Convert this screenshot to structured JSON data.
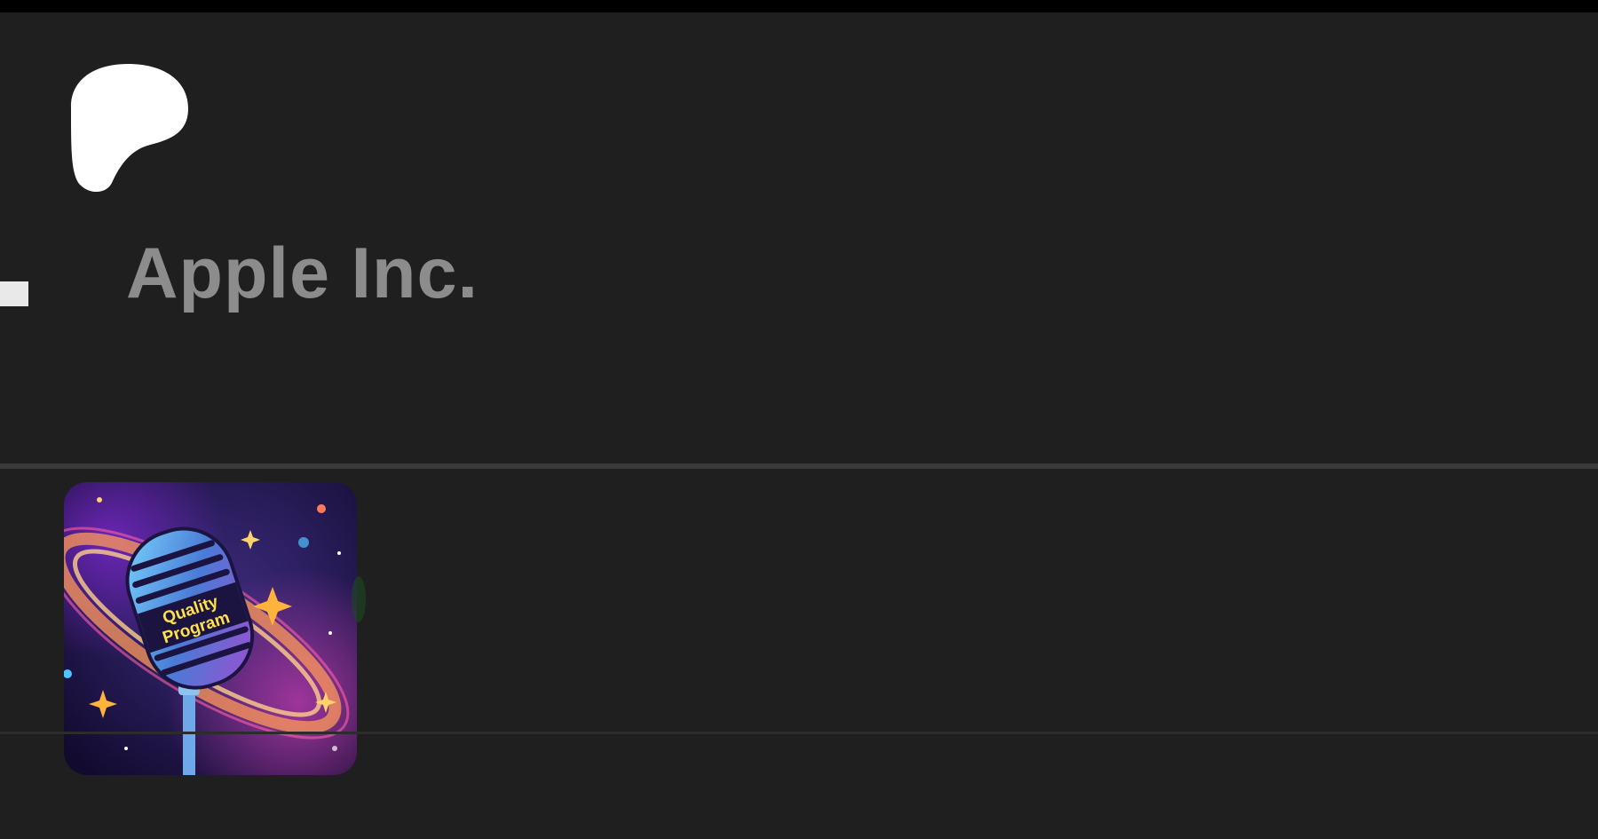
{
  "header": {
    "title": "Apple Inc."
  },
  "artwork": {
    "line1": "Quality",
    "line2": "Program"
  },
  "colors": {
    "background": "#1f1f1f",
    "title_text": "#8c8c8c",
    "logo": "#ffffff"
  }
}
